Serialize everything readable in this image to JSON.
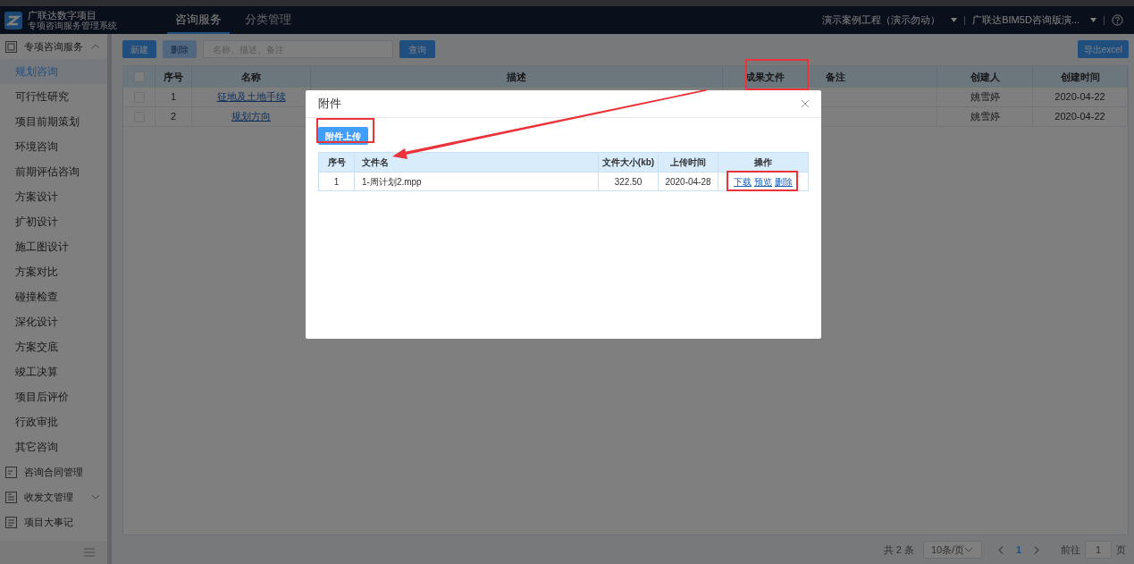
{
  "header": {
    "logo_title": "广联达数字项目",
    "logo_subtitle": "专项咨询服务管理系统",
    "nav": [
      {
        "label": "咨询服务",
        "selected": true
      },
      {
        "label": "分类管理",
        "selected": false
      }
    ],
    "project_select": "演示案例工程（演示勿动）",
    "org_select": "广联达BIM5D咨询版演..."
  },
  "sidebar": {
    "items": [
      {
        "label": "专项咨询服务",
        "expanded": true,
        "children": [
          {
            "label": "规划咨询",
            "selected": true
          },
          {
            "label": "可行性研究",
            "selected": false
          },
          {
            "label": "项目前期策划",
            "selected": false
          },
          {
            "label": "环境咨询",
            "selected": false
          },
          {
            "label": "前期评估咨询",
            "selected": false
          },
          {
            "label": "方案设计",
            "selected": false
          },
          {
            "label": "扩初设计",
            "selected": false
          },
          {
            "label": "施工图设计",
            "selected": false
          },
          {
            "label": "方案对比",
            "selected": false
          },
          {
            "label": "碰撞检查",
            "selected": false
          },
          {
            "label": "深化设计",
            "selected": false
          },
          {
            "label": "方案交底",
            "selected": false
          },
          {
            "label": "竣工决算",
            "selected": false
          },
          {
            "label": "项目后评价",
            "selected": false
          },
          {
            "label": "行政审批",
            "selected": false
          },
          {
            "label": "其它咨询",
            "selected": false
          }
        ]
      },
      {
        "label": "咨询合同管理"
      },
      {
        "label": "收发文管理",
        "expanded": false
      },
      {
        "label": "项目大事记"
      }
    ]
  },
  "toolbar": {
    "new_button": "新建",
    "delete_button": {
      "label": "删除",
      "disabled": true
    },
    "search": {
      "placeholder": "名称、描述、备注"
    },
    "query_button": "查询",
    "export_button": "导出excel"
  },
  "table": {
    "select_all_checked": false,
    "columns": [
      "序号",
      "名称",
      "描述",
      "成果文件",
      "备注",
      "创建人",
      "创建时间"
    ],
    "rows": [
      {
        "checked": false,
        "index": "1",
        "name": "征地及土地手续",
        "creator": "姚雪婷",
        "created": "2020-04-22"
      },
      {
        "checked": false,
        "index": "2",
        "name": "规划方向",
        "creator": "姚雪婷",
        "created": "2020-04-22"
      }
    ]
  },
  "pagination": {
    "total": "共 2 条",
    "page_size": "10条/页",
    "pages": [
      {
        "label": "1",
        "selected": true
      }
    ],
    "goto_label": "前往",
    "goto_value": "1",
    "goto_suffix": "页"
  },
  "dialog": {
    "title": "附件",
    "upload_button": "附件上传",
    "columns": [
      "序号",
      "文件名",
      "文件大小(kb)",
      "上传时间",
      "操作"
    ],
    "rows": [
      {
        "index": "1",
        "file_name": "1-周计划2.mpp",
        "size": "322.50",
        "uploaded": "2020-04-28",
        "actions": [
          "下载",
          "预览",
          "删除"
        ]
      }
    ]
  }
}
